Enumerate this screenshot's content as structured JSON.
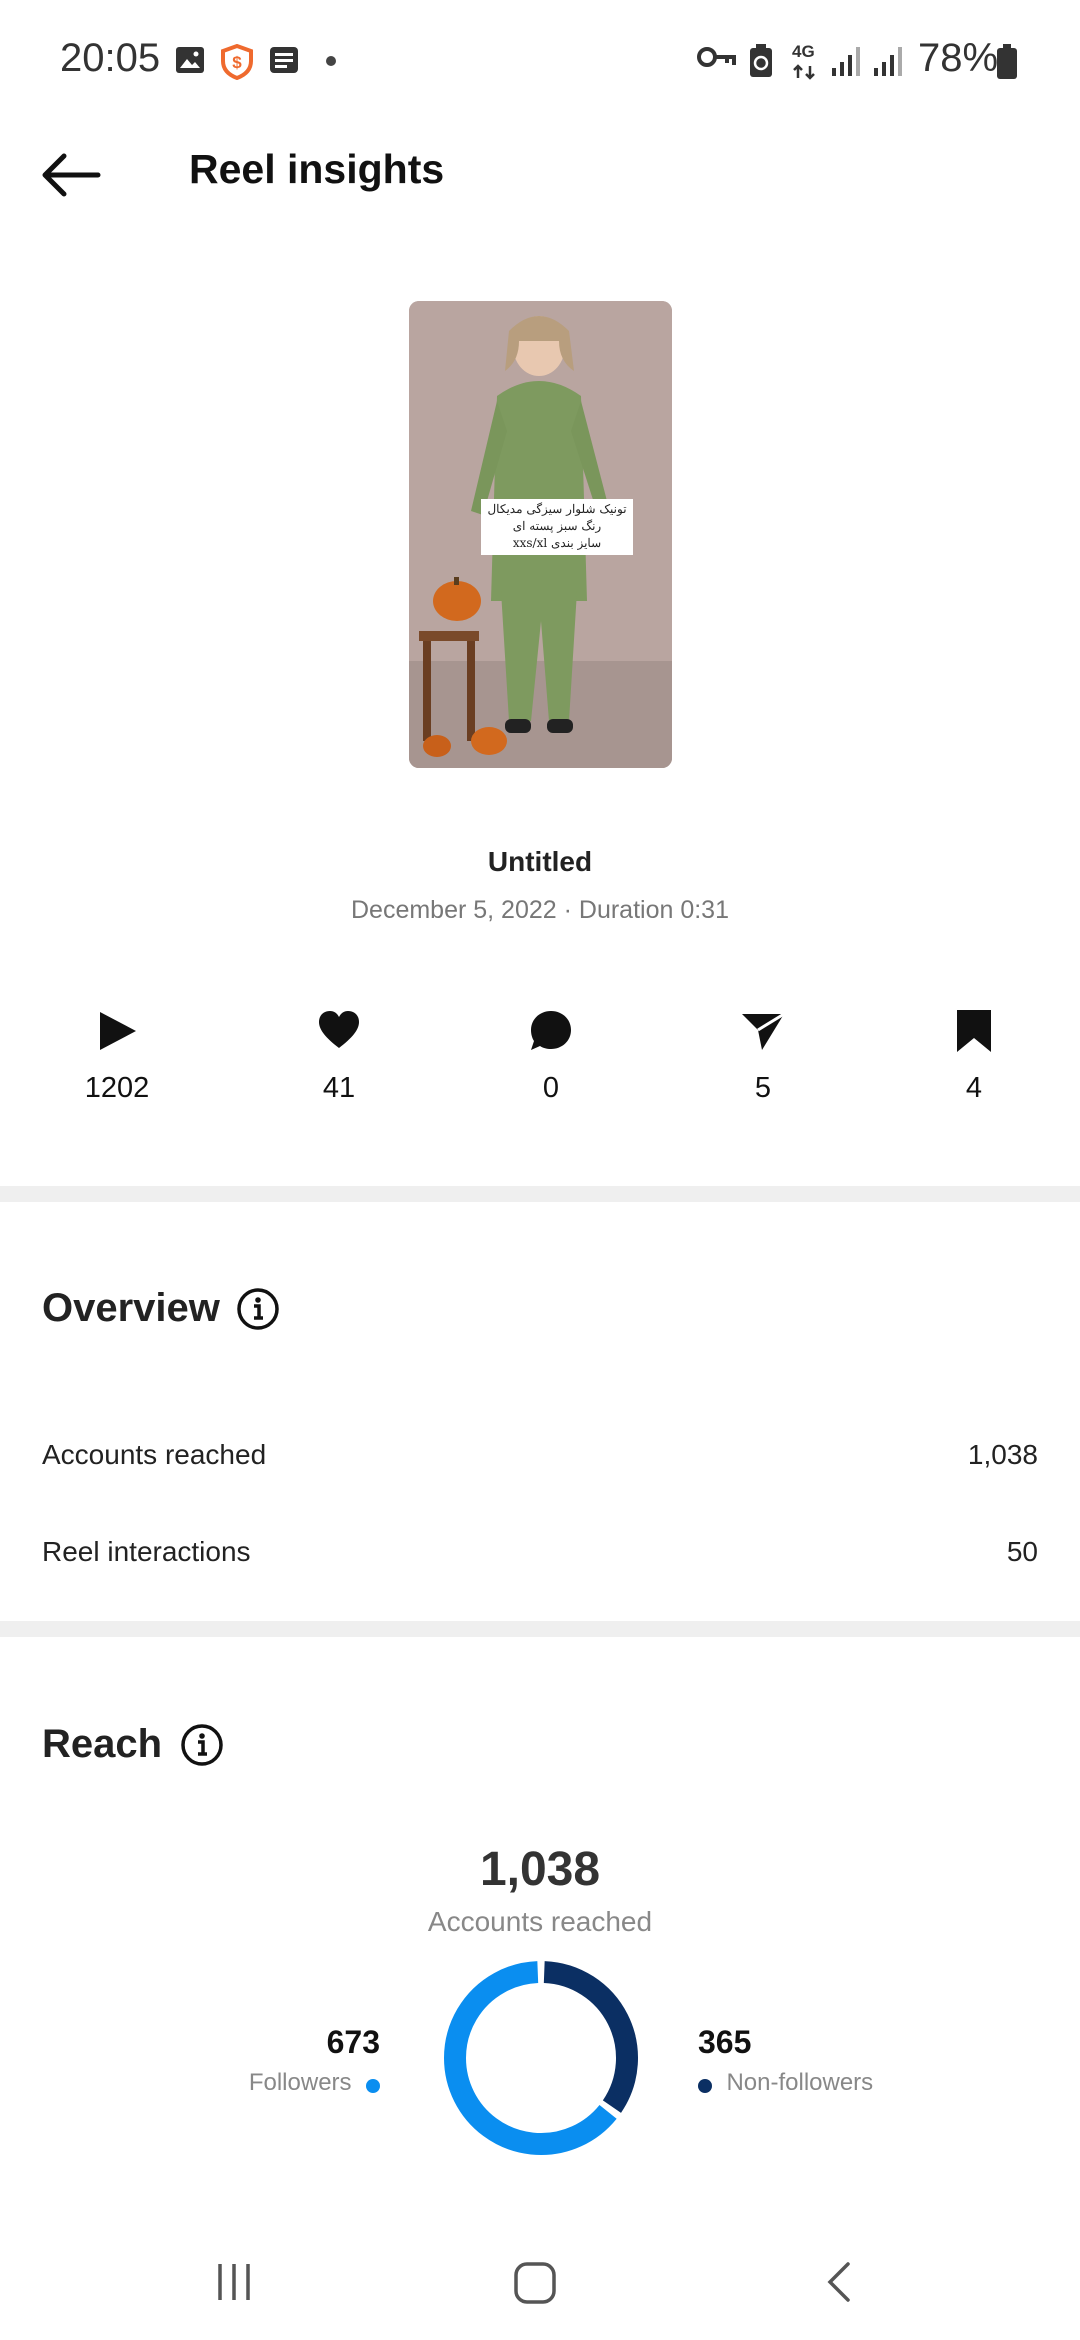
{
  "status_bar": {
    "time": "20:05",
    "network": "4G",
    "battery": "78%",
    "icons": [
      "gallery-icon",
      "shield-app-icon",
      "news-icon",
      "dot-icon",
      "vpn-key-icon",
      "battery-saver-icon",
      "signal-icon",
      "signal-icon",
      "battery-icon"
    ]
  },
  "header": {
    "title": "Reel insights",
    "back_icon": "arrow-left-icon"
  },
  "reel": {
    "caption_lines": [
      "تونیک شلوار سیزگی مدیکال",
      "رنگ سبز پسته ای",
      "سایز بندی xxs/xl"
    ],
    "title": "Untitled",
    "meta": "December 5, 2022 · Duration 0:31"
  },
  "metrics": {
    "plays": "1202",
    "likes": "41",
    "comments": "0",
    "shares": "5",
    "saves": "4"
  },
  "overview": {
    "title": "Overview",
    "rows": [
      {
        "label": "Accounts reached",
        "value": "1,038"
      },
      {
        "label": "Reel interactions",
        "value": "50"
      }
    ]
  },
  "reach": {
    "title": "Reach",
    "total": "1,038",
    "total_label": "Accounts reached",
    "followers": {
      "value": "673",
      "label": "Followers",
      "color": "#0a8ef0"
    },
    "non_followers": {
      "value": "365",
      "label": "Non-followers",
      "color": "#0b2f63"
    }
  },
  "chart_data": {
    "type": "pie",
    "categories": [
      "Followers",
      "Non-followers"
    ],
    "values": [
      673,
      365
    ],
    "colors": [
      "#0a8ef0",
      "#0b2f63"
    ]
  },
  "nav_bar": {
    "icons": [
      "recent-apps-icon",
      "home-icon",
      "back-nav-icon"
    ]
  }
}
